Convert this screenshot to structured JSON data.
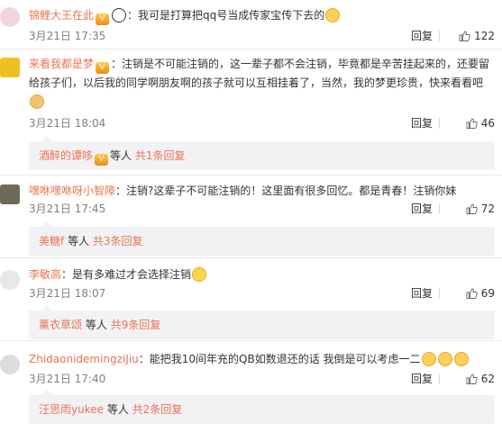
{
  "comments": [
    {
      "user": "锦鲤大王在此",
      "text": "：我可是打算把qq号当成传家宝传下去的",
      "time": "3月21日 17:35",
      "reply_label": "回复",
      "likes": "122"
    },
    {
      "user": "来看我都是梦",
      "text": "：注销是不可能注销的，这一辈子都不会注销，毕竟都是辛苦挂起来的，还要留给孩子们，以后我的同学啊朋友啊的孩子就可以互相挂着了，当然，我的梦更珍贵，快来看看吧",
      "time": "3月21日 18:04",
      "reply_label": "回复",
      "likes": "46",
      "sub": {
        "users": "酒醉的谭哆",
        "etc": "等人",
        "summary": "共1条回复"
      }
    },
    {
      "user": "嘿咻嘿咻呀小智障",
      "text": "：注销?这辈子不可能注销的！这里面有很多回忆。都是青春！注销你妹",
      "time": "3月21日 17:45",
      "reply_label": "回复",
      "likes": "72",
      "sub": {
        "users": "美糖f",
        "etc": "等人",
        "summary": "共3条回复"
      }
    },
    {
      "user": "李敏高",
      "text": "：是有多难过才会选择注销",
      "time": "3月21日 18:07",
      "reply_label": "回复",
      "likes": "69",
      "sub": {
        "users": "薰衣草颂",
        "etc": "等人",
        "summary": "共9条回复"
      }
    },
    {
      "user": "ZhidaonidemingziJiu",
      "text": "：能把我10间年充的QB如数退还的话 我倒是可以考虑一二",
      "time": "3月21日 17:40",
      "reply_label": "回复",
      "likes": "62",
      "sub": {
        "users": "汪思雨yukee",
        "etc": "等人",
        "summary": "共2条回复"
      }
    }
  ],
  "icons": {
    "badge": "vip-badge-icon",
    "like": "thumb-up-icon",
    "emoji_panda": "panda-emoji-icon",
    "emoji_cat": "cat-emoji-icon",
    "emoji_sad": "sad-face-emoji-icon"
  },
  "colors": {
    "username": "#eb7350",
    "meta": "#808080",
    "sub_background": "#f2f2f5"
  }
}
